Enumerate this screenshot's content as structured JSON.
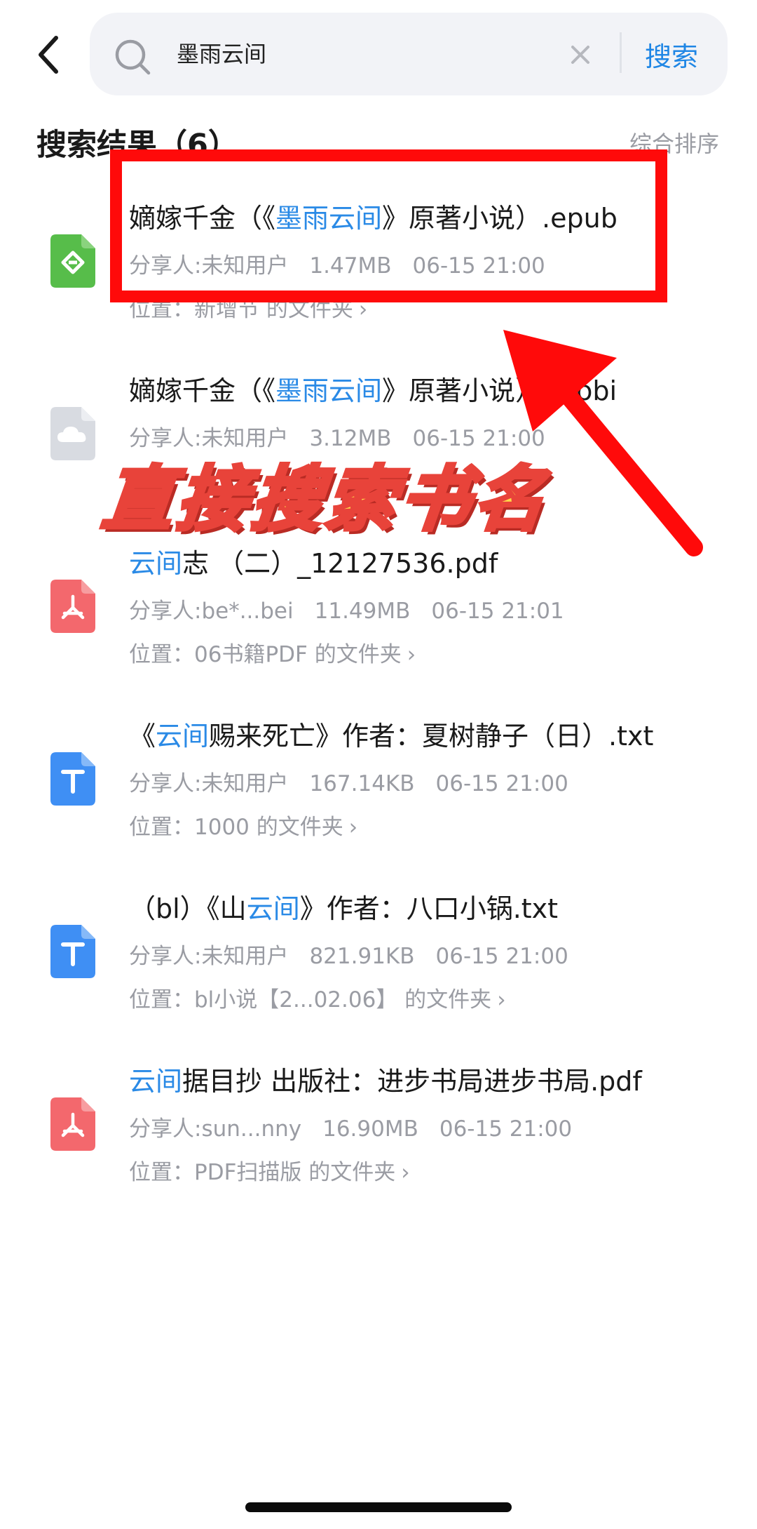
{
  "search": {
    "query": "墨雨云间",
    "button_label": "搜索"
  },
  "results": {
    "heading": "搜索结果（6）",
    "sort_label": "综合排序",
    "items": [
      {
        "icon": "epub-file-icon",
        "icon_color": "#57bd4a",
        "title_pre": "嫡嫁千金（《",
        "title_hl": "墨雨云间",
        "title_post": "》原著小说）.epub",
        "sharer": "分享人:未知用户",
        "size": "1.47MB",
        "time": "06-15 21:00",
        "location": "位置：新增节 的文件夹"
      },
      {
        "icon": "cloud-file-icon",
        "icon_color": "#d8dbe1",
        "title_pre": "嫡嫁千金（《",
        "title_hl": "墨雨云间",
        "title_post": "》原著小说）.mobi",
        "sharer": "分享人:未知用户",
        "size": "3.12MB",
        "time": "06-15 21:00",
        "location": ""
      },
      {
        "icon": "pdf-file-icon",
        "icon_color": "#f3686d",
        "title_pre": "",
        "title_hl": "云间",
        "title_post": "志 （二）_12127536.pdf",
        "sharer": "分享人:be*...bei",
        "size": "11.49MB",
        "time": "06-15 21:01",
        "location": "位置：06书籍PDF 的文件夹"
      },
      {
        "icon": "txt-file-icon",
        "icon_color": "#3f8ff4",
        "title_pre": "《",
        "title_hl": "云间",
        "title_post": "赐来死亡》作者：夏树静子（日）.txt",
        "sharer": "分享人:未知用户",
        "size": "167.14KB",
        "time": "06-15 21:00",
        "location": "位置：1000 的文件夹"
      },
      {
        "icon": "txt-file-icon",
        "icon_color": "#3f8ff4",
        "title_pre": "（bl）《山",
        "title_hl": "云间",
        "title_post": "》作者：八口小锅.txt",
        "sharer": "分享人:未知用户",
        "size": "821.91KB",
        "time": "06-15 21:00",
        "location": "位置：bl小说【2...02.06】 的文件夹"
      },
      {
        "icon": "pdf-file-icon",
        "icon_color": "#f3686d",
        "title_pre": "",
        "title_hl": "云间",
        "title_post": "据目抄 出版社：进步书局进步书局.pdf",
        "sharer": "分享人:sun...nny",
        "size": "16.90MB",
        "time": "06-15 21:00",
        "location": "位置：PDF扫描版 的文件夹"
      }
    ]
  },
  "annotation": {
    "overlay_text": "直接搜索书名",
    "highlight_color": "#ff0a0a"
  },
  "colors": {
    "accent": "#1f86e5",
    "highlight_text": "#2a8ae6",
    "secondary_text": "#9a9ca3"
  }
}
